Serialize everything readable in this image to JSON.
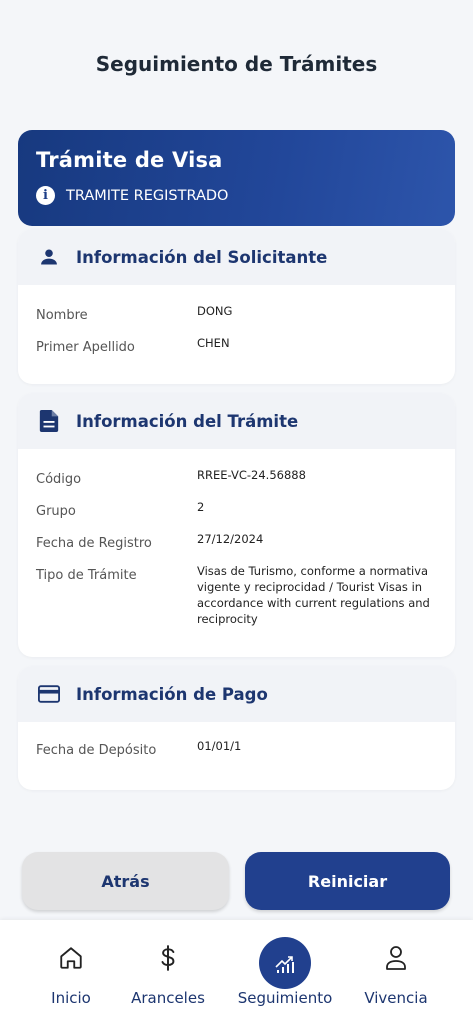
{
  "header": {
    "title": "Seguimiento de Trámites"
  },
  "hero": {
    "title": "Trámite de Visa",
    "status": "TRAMITE REGISTRADO",
    "info_icon_glyph": "i"
  },
  "applicant": {
    "title": "Información del Solicitante",
    "rows": [
      {
        "label": "Nombre",
        "value": "DONG"
      },
      {
        "label": "Primer Apellido",
        "value": "CHEN"
      }
    ]
  },
  "procedure": {
    "title": "Información del Trámite",
    "rows": [
      {
        "label": "Código",
        "value": "RREE-VC-24.56888"
      },
      {
        "label": "Grupo",
        "value": "2"
      },
      {
        "label": "Fecha de Registro",
        "value": "27/12/2024"
      },
      {
        "label": "Tipo de Trámite",
        "value": "Visas de Turismo, conforme a normativa vigente y reciprocidad / Tourist Visas in accordance with current regulations and reciprocity"
      }
    ]
  },
  "payment": {
    "title": "Información de Pago",
    "rows": [
      {
        "label": "Fecha de Depósito",
        "value": "01/01/1"
      }
    ]
  },
  "actions": {
    "back_label": "Atrás",
    "reset_label": "Reiniciar"
  },
  "nav": {
    "items": [
      {
        "label": "Inicio",
        "icon": "home-icon"
      },
      {
        "label": "Aranceles",
        "icon": "dollar-icon"
      },
      {
        "label": "Seguimiento",
        "icon": "chart-icon",
        "active": true
      },
      {
        "label": "Vivencia",
        "icon": "person-icon"
      }
    ]
  },
  "colors": {
    "primary": "#21408e",
    "title_text": "#1d3670",
    "background": "#f4f6f9"
  }
}
